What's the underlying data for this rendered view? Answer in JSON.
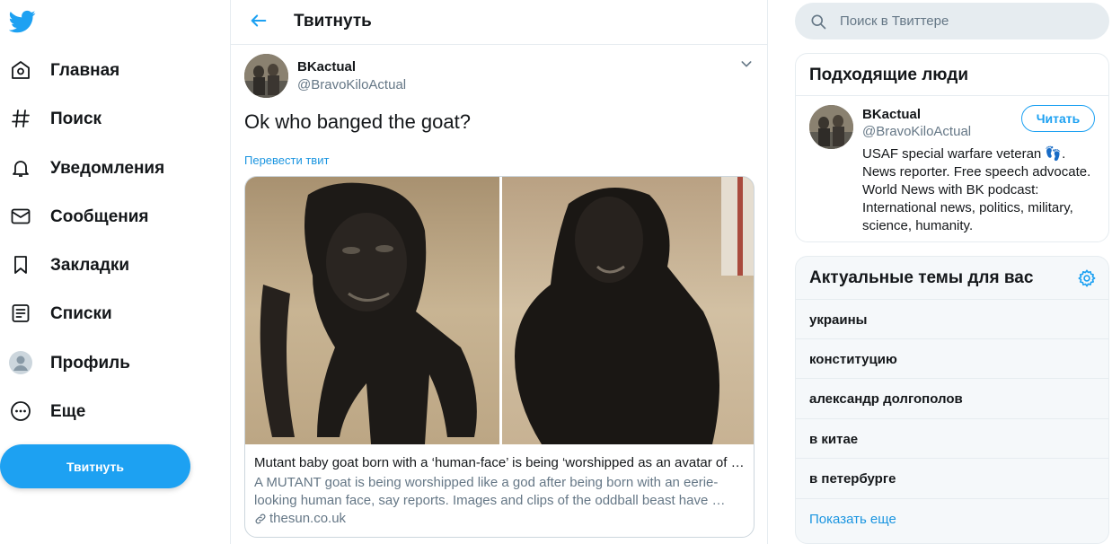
{
  "nav": {
    "logo_icon": "twitter-bird-icon",
    "items": [
      {
        "label": "Главная",
        "icon": "home-icon"
      },
      {
        "label": "Поиск",
        "icon": "hashtag-icon"
      },
      {
        "label": "Уведомления",
        "icon": "bell-icon"
      },
      {
        "label": "Сообщения",
        "icon": "envelope-icon"
      },
      {
        "label": "Закладки",
        "icon": "bookmark-icon"
      },
      {
        "label": "Списки",
        "icon": "list-icon"
      },
      {
        "label": "Профиль",
        "icon": "profile-avatar-icon"
      },
      {
        "label": "Еще",
        "icon": "more-dots-icon"
      }
    ],
    "tweet_button": "Твитнуть"
  },
  "header": {
    "title": "Твитнуть",
    "back_icon": "back-arrow-icon"
  },
  "tweet": {
    "author_name": "BKactual",
    "author_handle": "@BravoKiloActual",
    "text": "Ok who banged the goat?",
    "translate_label": "Перевести твит",
    "card": {
      "title": "Mutant baby goat born with a ‘human-face’ is being ‘worshipped as an avatar of …",
      "description": "A MUTANT goat is being worshipped like a god after being born with an eerie-looking human face, say reports. Images and clips of the oddball beast have …",
      "domain": "thesun.co.uk"
    }
  },
  "search": {
    "placeholder": "Поиск в Твиттере"
  },
  "who_to_follow": {
    "title": "Подходящие люди",
    "name": "BKactual",
    "handle": "@BravoKiloActual",
    "follow_label": "Читать",
    "bio": "USAF special warfare veteran 👣. News reporter. Free speech advocate. World News with BK podcast: International news, politics, military, science, humanity."
  },
  "trends": {
    "title": "Актуальные темы для вас",
    "items": [
      "украины",
      "конституцию",
      "александр долгополов",
      "в китае",
      "в петербурге"
    ],
    "show_more": "Показать еще"
  },
  "colors": {
    "accent": "#1da1f2",
    "link": "#1b95e0",
    "text": "#14171a",
    "secondary": "#657786",
    "border": "#e6ecf0"
  }
}
